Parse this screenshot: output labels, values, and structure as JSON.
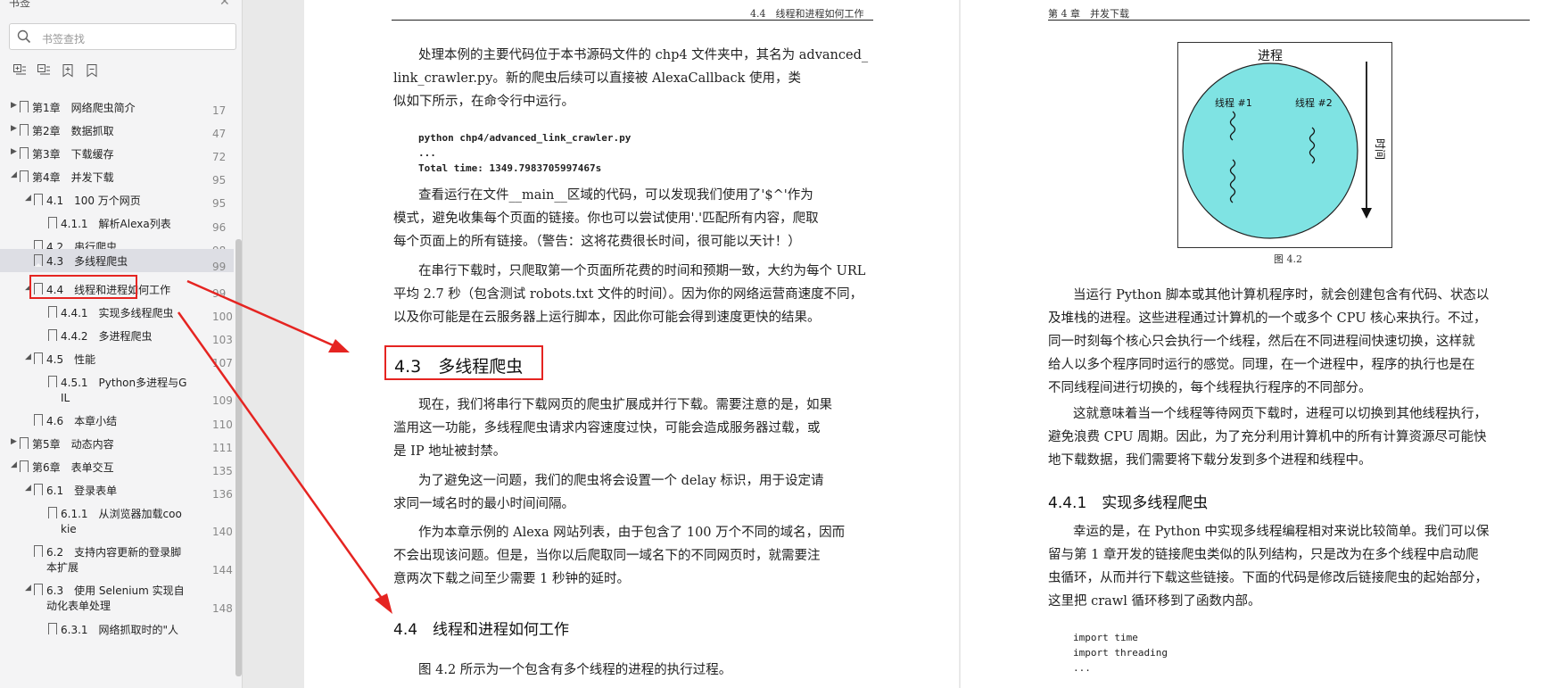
{
  "sidebar": {
    "title": "书签",
    "search_placeholder": "书签查找",
    "toc": [
      {
        "label": "第1章　网络爬虫简介",
        "page": "17"
      },
      {
        "label": "第2章　数据抓取",
        "page": "47"
      },
      {
        "label": "第3章　下载缓存",
        "page": "72"
      },
      {
        "label": "第4章　并发下载",
        "page": "95"
      },
      {
        "label": "4.1　100 万个网页",
        "page": "95"
      },
      {
        "label": "4.1.1　解析Alexa列表",
        "page": "96"
      },
      {
        "label": "4.2　串行爬虫",
        "page": "98"
      },
      {
        "label": "4.3　多线程爬虫",
        "page": "99"
      },
      {
        "label": "4.4　线程和进程如何工作",
        "page": "99"
      },
      {
        "label": "4.4.1　实现多线程爬虫",
        "page": "100"
      },
      {
        "label": "4.4.2　多进程爬虫",
        "page": "103"
      },
      {
        "label": "4.5　性能",
        "page": "107"
      },
      {
        "label": "4.5.1　Python多进程与G",
        "label2": "IL",
        "page": "109"
      },
      {
        "label": "4.6　本章小结",
        "page": "110"
      },
      {
        "label": "第5章　动态内容",
        "page": "111"
      },
      {
        "label": "第6章　表单交互",
        "page": "135"
      },
      {
        "label": "6.1　登录表单",
        "page": "136"
      },
      {
        "label": "6.1.1　从浏览器加载coo",
        "label2": "kie",
        "page": "140"
      },
      {
        "label": "6.2　支持内容更新的登录脚",
        "label2": "本扩展",
        "page": "144"
      },
      {
        "label": "6.3　使用 Selenium 实现自",
        "label2": "动化表单处理",
        "page": "148"
      },
      {
        "label": "6.3.1　网络抓取时的\"人",
        "page": ""
      }
    ]
  },
  "page1": {
    "header": "4.4　线程和进程如何工作",
    "p1": [
      "处理本例的主要代码位于本书源码文件的 chp4 文件夹中，其名为 advanced_",
      "link_crawler.py。新的爬虫后续可以直接被 AlexaCallback 使用，类",
      "似如下所示，在命令行中运行。"
    ],
    "code": [
      "python chp4/advanced_link_crawler.py",
      "...",
      "Total time: 1349.7983705997467s"
    ],
    "p2": [
      "查看运行在文件__main__区域的代码，可以发现我们使用了'$^'作为",
      "模式，避免收集每个页面的链接。你也可以尝试使用'.'匹配所有内容，爬取",
      "每个页面上的所有链接。（警告：这将花费很长时间，很可能以天计！）"
    ],
    "p3": [
      "在串行下载时，只爬取第一个页面所花费的时间和预期一致，大约为每个 URL",
      "平均 2.7 秒（包含测试 robots.txt 文件的时间）。因为你的网络运营商速度不同，",
      "以及你可能是在云服务器上运行脚本，因此你可能会得到速度更快的结果。"
    ],
    "h43": "4.3　多线程爬虫",
    "p4": [
      "现在，我们将串行下载网页的爬虫扩展成并行下载。需要注意的是，如果",
      "滥用这一功能，多线程爬虫请求内容速度过快，可能会造成服务器过载，或",
      "是 IP 地址被封禁。"
    ],
    "p5": [
      "为了避免这一问题，我们的爬虫将会设置一个 delay 标识，用于设定请",
      "求同一域名时的最小时间间隔。"
    ],
    "p6": [
      "作为本章示例的 Alexa 网站列表，由于包含了 100 万个不同的域名，因而",
      "不会出现该问题。但是，当你以后爬取同一域名下的不同网页时，就需要注",
      "意两次下载之间至少需要 1 秒钟的延时。"
    ],
    "h44": "4.4　线程和进程如何工作",
    "p7": "图 4.2 所示为一个包含有多个线程的进程的执行过程。"
  },
  "page2": {
    "header": "第 4 章　并发下载",
    "figure": {
      "process": "进程",
      "t1": "线程 #1",
      "t2": "线程 #2",
      "time": "时间",
      "caption": "图 4.2"
    },
    "p1": [
      "当运行 Python 脚本或其他计算机程序时，就会创建包含有代码、状态以",
      "及堆栈的进程。这些进程通过计算机的一个或多个 CPU 核心来执行。不过，",
      "同一时刻每个核心只会执行一个线程，然后在不同进程间快速切换，这样就",
      "给人以多个程序同时运行的感觉。同理，在一个进程中，程序的执行也是在",
      "不同线程间进行切换的，每个线程执行程序的不同部分。"
    ],
    "p2": [
      "这就意味着当一个线程等待网页下载时，进程可以切换到其他线程执行，",
      "避免浪费 CPU 周期。因此，为了充分利用计算机中的所有计算资源尽可能快",
      "地下载数据，我们需要将下载分发到多个进程和线程中。"
    ],
    "h441": "4.4.1　实现多线程爬虫",
    "p3": [
      "幸运的是，在 Python 中实现多线程编程相对来说比较简单。我们可以保",
      "留与第 1 章开发的链接爬虫类似的队列结构，只是改为在多个线程中启动爬",
      "虫循环，从而并行下载这些链接。下面的代码是修改后链接爬虫的起始部分，",
      "这里把 crawl 循环移到了函数内部。"
    ],
    "code": [
      "import time",
      "import threading",
      "..."
    ]
  },
  "colors": {
    "accent_red": "#e52421",
    "figure_fill": "#7fe3e3"
  }
}
